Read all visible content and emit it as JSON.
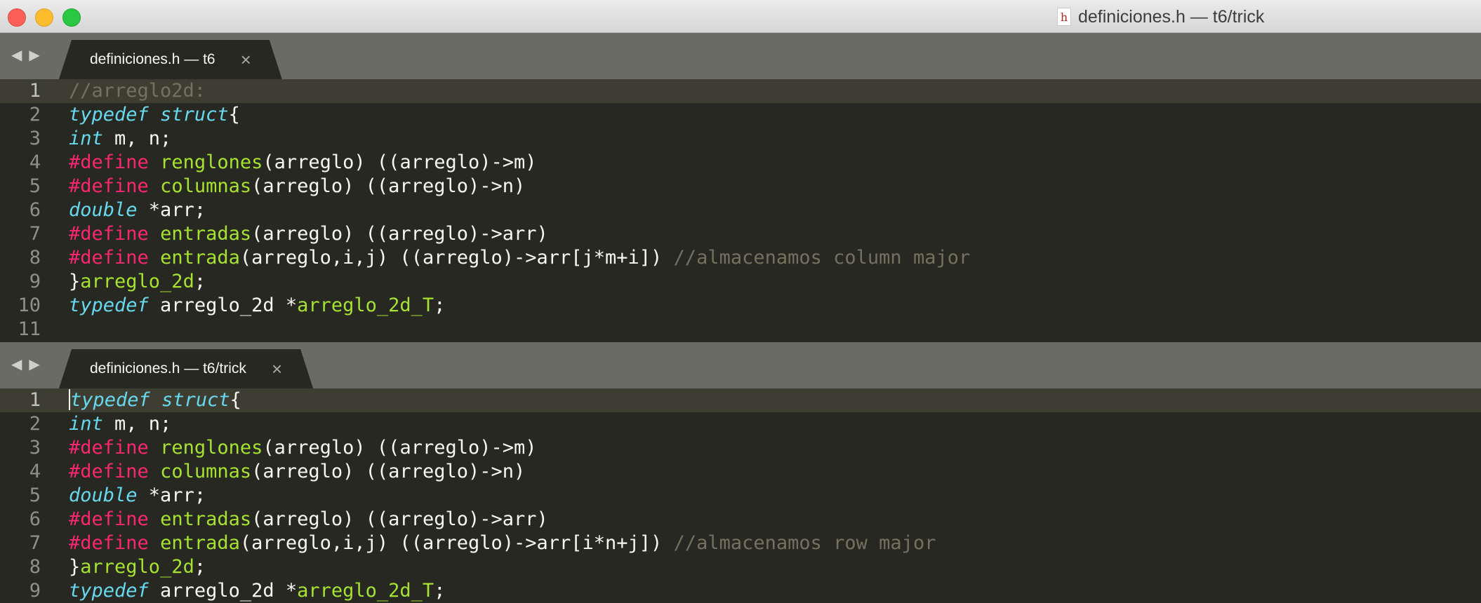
{
  "window": {
    "title": "definiciones.h — t6/trick",
    "file_icon_glyph": "h"
  },
  "panes": [
    {
      "tab_label": "definiciones.h — t6",
      "tab_close": "×",
      "lines": [
        {
          "n": "1",
          "tokens": [
            {
              "t": "//arreglo2d:",
              "c": "cm"
            }
          ]
        },
        {
          "n": "2",
          "tokens": [
            {
              "t": "typedef",
              "c": "kw"
            },
            {
              "t": " "
            },
            {
              "t": "struct",
              "c": "kw"
            },
            {
              "t": "{"
            }
          ]
        },
        {
          "n": "3",
          "tokens": [
            {
              "t": "int",
              "c": "kw"
            },
            {
              "t": " m, n;"
            }
          ]
        },
        {
          "n": "4",
          "tokens": [
            {
              "t": "#define",
              "c": "pp"
            },
            {
              "t": " "
            },
            {
              "t": "renglones",
              "c": "fn"
            },
            {
              "t": "(arreglo) ((arreglo)->m)"
            }
          ]
        },
        {
          "n": "5",
          "tokens": [
            {
              "t": "#define",
              "c": "pp"
            },
            {
              "t": " "
            },
            {
              "t": "columnas",
              "c": "fn"
            },
            {
              "t": "(arreglo) ((arreglo)->n)"
            }
          ]
        },
        {
          "n": "6",
          "tokens": [
            {
              "t": "double",
              "c": "kw"
            },
            {
              "t": " *arr;"
            }
          ]
        },
        {
          "n": "7",
          "tokens": [
            {
              "t": "#define",
              "c": "pp"
            },
            {
              "t": " "
            },
            {
              "t": "entradas",
              "c": "fn"
            },
            {
              "t": "(arreglo) ((arreglo)->arr)"
            }
          ]
        },
        {
          "n": "8",
          "tokens": [
            {
              "t": "#define",
              "c": "pp"
            },
            {
              "t": " "
            },
            {
              "t": "entrada",
              "c": "fn"
            },
            {
              "t": "(arreglo,i,j) ((arreglo)->arr[j*m+i]) "
            },
            {
              "t": "//almacenamos column major",
              "c": "cm"
            }
          ]
        },
        {
          "n": "9",
          "tokens": [
            {
              "t": "}"
            },
            {
              "t": "arreglo_2d",
              "c": "fn"
            },
            {
              "t": ";"
            }
          ]
        },
        {
          "n": "10",
          "tokens": [
            {
              "t": "typedef",
              "c": "kw"
            },
            {
              "t": " arreglo_2d *"
            },
            {
              "t": "arreglo_2d_T",
              "c": "fn"
            },
            {
              "t": ";"
            }
          ]
        },
        {
          "n": "11",
          "tokens": []
        }
      ],
      "current_line": 0,
      "cursor": false
    },
    {
      "tab_label": "definiciones.h — t6/trick",
      "tab_close": "×",
      "lines": [
        {
          "n": "1",
          "tokens": [
            {
              "t": "typedef",
              "c": "kw"
            },
            {
              "t": " "
            },
            {
              "t": "struct",
              "c": "kw"
            },
            {
              "t": "{"
            }
          ]
        },
        {
          "n": "2",
          "tokens": [
            {
              "t": "int",
              "c": "kw"
            },
            {
              "t": " m, n;"
            }
          ]
        },
        {
          "n": "3",
          "tokens": [
            {
              "t": "#define",
              "c": "pp"
            },
            {
              "t": " "
            },
            {
              "t": "renglones",
              "c": "fn"
            },
            {
              "t": "(arreglo) ((arreglo)->m)"
            }
          ]
        },
        {
          "n": "4",
          "tokens": [
            {
              "t": "#define",
              "c": "pp"
            },
            {
              "t": " "
            },
            {
              "t": "columnas",
              "c": "fn"
            },
            {
              "t": "(arreglo) ((arreglo)->n)"
            }
          ]
        },
        {
          "n": "5",
          "tokens": [
            {
              "t": "double",
              "c": "kw"
            },
            {
              "t": " *arr;"
            }
          ]
        },
        {
          "n": "6",
          "tokens": [
            {
              "t": "#define",
              "c": "pp"
            },
            {
              "t": " "
            },
            {
              "t": "entradas",
              "c": "fn"
            },
            {
              "t": "(arreglo) ((arreglo)->arr)"
            }
          ]
        },
        {
          "n": "7",
          "tokens": [
            {
              "t": "#define",
              "c": "pp"
            },
            {
              "t": " "
            },
            {
              "t": "entrada",
              "c": "fn"
            },
            {
              "t": "(arreglo,i,j) ((arreglo)->arr[i*n+j]) "
            },
            {
              "t": "//almacenamos row major",
              "c": "cm"
            }
          ]
        },
        {
          "n": "8",
          "tokens": [
            {
              "t": "}"
            },
            {
              "t": "arreglo_2d",
              "c": "fn"
            },
            {
              "t": ";"
            }
          ]
        },
        {
          "n": "9",
          "tokens": [
            {
              "t": "typedef",
              "c": "kw"
            },
            {
              "t": " arreglo_2d *"
            },
            {
              "t": "arreglo_2d_T",
              "c": "fn"
            },
            {
              "t": ";"
            }
          ]
        }
      ],
      "current_line": 0,
      "cursor": true
    }
  ],
  "colors": {
    "editor_bg": "#272822",
    "tabbar_bg": "#6b6b66",
    "keyword": "#66d9ef",
    "preprocessor": "#f92672",
    "function": "#a6e22e",
    "comment": "#75715e",
    "text": "#f8f8f2"
  },
  "icons": {
    "nav_back": "◀",
    "nav_forward": "▶"
  }
}
